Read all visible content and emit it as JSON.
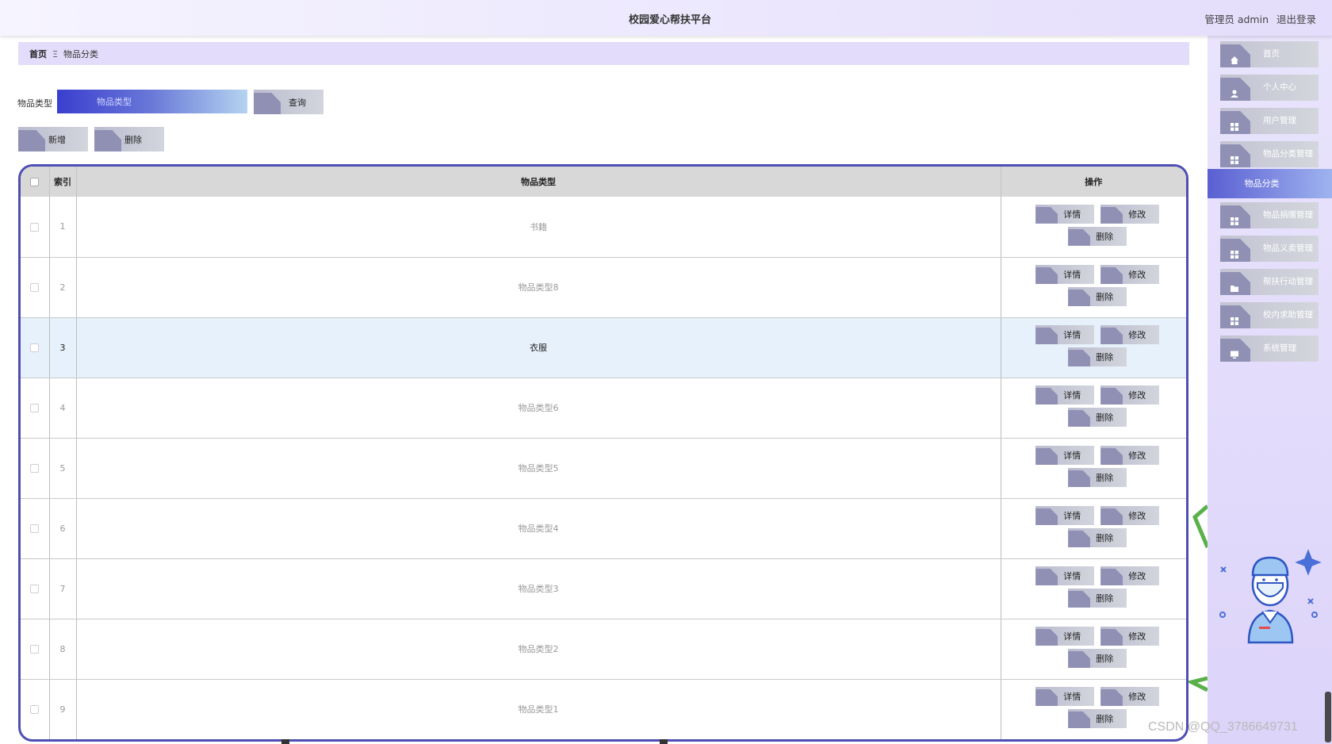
{
  "app": {
    "title": "校园爱心帮扶平台",
    "user_label": "管理员 admin",
    "logout_label": "退出登录"
  },
  "breadcrumb": {
    "home": "首页",
    "separator": "Ξ",
    "current": "物品分类"
  },
  "search": {
    "label": "物品类型",
    "placeholder": "物品类型",
    "query_button": "查询"
  },
  "toolbar": {
    "add_button": "新增",
    "delete_button": "删除"
  },
  "table": {
    "columns": {
      "index": "索引",
      "type": "物品类型",
      "actions": "操作"
    },
    "action_labels": {
      "detail": "详情",
      "edit": "修改",
      "delete": "删除"
    },
    "rows": [
      {
        "index": "1",
        "type": "书籍"
      },
      {
        "index": "2",
        "type": "物品类型8"
      },
      {
        "index": "3",
        "type": "衣服",
        "highlighted": true
      },
      {
        "index": "4",
        "type": "物品类型6"
      },
      {
        "index": "5",
        "type": "物品类型5"
      },
      {
        "index": "6",
        "type": "物品类型4"
      },
      {
        "index": "7",
        "type": "物品类型3"
      },
      {
        "index": "8",
        "type": "物品类型2"
      },
      {
        "index": "9",
        "type": "物品类型1"
      }
    ]
  },
  "sidebar": {
    "items": [
      {
        "label": "首页",
        "icon": "home-icon"
      },
      {
        "label": "个人中心",
        "icon": "user-icon"
      },
      {
        "label": "用户管理",
        "icon": "grid-icon"
      },
      {
        "label": "物品分类管理",
        "icon": "grid-icon"
      }
    ],
    "active_item": "物品分类",
    "items_after": [
      {
        "label": "物品捐赠管理",
        "icon": "grid-icon"
      },
      {
        "label": "物品义卖管理",
        "icon": "grid-icon"
      },
      {
        "label": "帮扶行动管理",
        "icon": "folder-icon"
      },
      {
        "label": "校内求助管理",
        "icon": "grid-icon"
      },
      {
        "label": "系统管理",
        "icon": "monitor-icon"
      }
    ]
  },
  "watermark": "CSDN @QQ_3786649731",
  "colors": {
    "accent": "#4e4eb4",
    "sidebar_bg": "#e4ddfb",
    "highlight_row": "#e6f1fb"
  }
}
